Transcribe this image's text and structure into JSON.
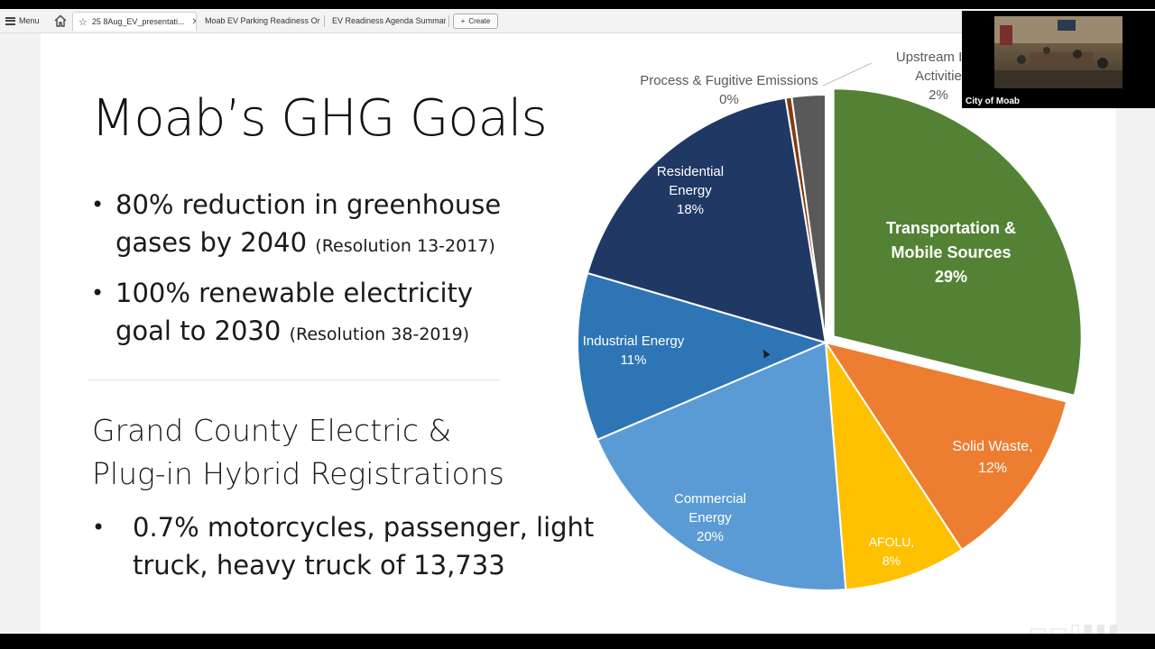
{
  "browser": {
    "menu_label": "Menu",
    "tabs": [
      {
        "label": "25 8Aug_EV_presentati..."
      },
      {
        "label": "Moab EV Parking Readiness Ord..."
      },
      {
        "label": "EV Readiness Agenda Summary..."
      }
    ],
    "create_label": "Create"
  },
  "slide": {
    "title": "Moab’s GHG Goals",
    "bullets": [
      {
        "text": "80% reduction in greenhouse",
        "text2": "gases by 2040 ",
        "note": "(Resolution 13-2017)"
      },
      {
        "text": "100% renewable electricity",
        "text2": "goal to 2030 ",
        "note": "(Resolution 38-2019)"
      }
    ],
    "subhead_line1": "Grand County Electric &",
    "subhead_line2": "Plug-in Hybrid Registrations",
    "reg_line1": "0.7% motorcycles, passenger, light",
    "reg_line2": "truck, heavy truck of 13,733"
  },
  "video": {
    "label": "City of Moab"
  },
  "chart_data": {
    "type": "pie",
    "slices": [
      {
        "name": "Transportation & Mobile Sources",
        "lines": [
          "Transportation &",
          "Mobile Sources",
          "29%"
        ],
        "value": 29,
        "color": "#548235"
      },
      {
        "name": "Solid Waste",
        "lines": [
          "Solid Waste,",
          "12%"
        ],
        "value": 12,
        "color": "#ed7d31"
      },
      {
        "name": "AFOLU",
        "lines": [
          "AFOLU,",
          "8%"
        ],
        "value": 8,
        "color": "#ffc000"
      },
      {
        "name": "Commercial Energy",
        "lines": [
          "Commercial",
          "Energy",
          "20%"
        ],
        "value": 20,
        "color": "#5b9bd5"
      },
      {
        "name": "Industrial Energy",
        "lines": [
          "Industrial Energy",
          "11%"
        ],
        "value": 11,
        "color": "#2e75b6"
      },
      {
        "name": "Residential Energy",
        "lines": [
          "Residential",
          "Energy",
          "18%"
        ],
        "value": 18,
        "color": "#203864"
      },
      {
        "name": "Process & Fugitive Emissions",
        "lines": [
          "Process & Fugitive Emissions",
          "0%"
        ],
        "value": 0.4,
        "color": "#843c0c"
      },
      {
        "name": "Upstream Impact Activities",
        "lines": [
          "Upstream Imp",
          "Activitie",
          "2%"
        ],
        "value": 2.2,
        "color": "#595959"
      }
    ]
  }
}
